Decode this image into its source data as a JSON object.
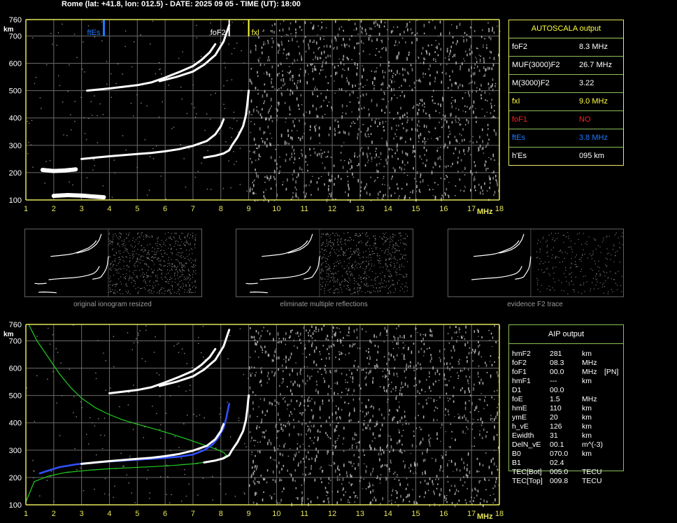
{
  "title": "Rome (lat: +41.8, lon: 012.5) - DATE: 2025 09 05 - TIME (UT): 18:00",
  "colors": {
    "axis": "#e6e65a",
    "grid": "#6a6a6a",
    "trace": "#ffffff",
    "ftEs": "#1e7bff",
    "fxl": "#ffff40",
    "foF1": "#ff2020",
    "profile": "#20d020",
    "blue": "#3050ff"
  },
  "chart_data": [
    {
      "type": "scatter",
      "panel": "main-ionogram",
      "xlabel": "MHz",
      "ylabel": "km",
      "xlim": [
        1,
        18
      ],
      "ylim": [
        100,
        760
      ],
      "xticks": [
        "1",
        "2",
        "3",
        "4",
        "5",
        "6",
        "7",
        "8",
        "9",
        "10",
        "11",
        "12",
        "13",
        "14",
        "15",
        "16",
        "17",
        "18"
      ],
      "yticks": [
        "100",
        "200",
        "300",
        "400",
        "500",
        "600",
        "700",
        "760"
      ],
      "grid": true,
      "markers": [
        {
          "label": "ftEs",
          "x": 3.8,
          "color": "#1e7bff"
        },
        {
          "label": "foF2",
          "x": 8.3,
          "color": "#ffffff"
        },
        {
          "label": "fxl",
          "x": 9.0,
          "color": "#ffff40"
        }
      ],
      "series": [
        {
          "x": [
            2.0,
            2.5,
            3.0,
            3.5,
            3.8
          ],
          "y": [
            115,
            118,
            116,
            112,
            110
          ]
        },
        {
          "x": [
            1.6,
            2.0,
            2.4,
            2.8
          ],
          "y": [
            210,
            206,
            208,
            212
          ]
        },
        {
          "x": [
            3.0,
            3.5,
            4.0,
            4.5,
            5.0,
            5.5,
            6.0,
            6.5,
            7.0,
            7.5,
            7.8,
            8.0,
            8.1
          ],
          "y": [
            250,
            255,
            260,
            264,
            268,
            272,
            278,
            286,
            298,
            316,
            340,
            370,
            395
          ]
        },
        {
          "x": [
            7.4,
            7.8,
            8.1,
            8.3,
            8.4,
            8.6,
            8.8,
            8.9,
            8.95,
            9.0
          ],
          "y": [
            255,
            262,
            270,
            282,
            300,
            330,
            370,
            410,
            450,
            500
          ]
        },
        {
          "x": [
            3.2,
            4.0,
            5.0,
            5.5,
            6.0,
            6.5,
            7.0,
            7.3,
            7.6,
            7.8
          ],
          "y": [
            500,
            508,
            520,
            530,
            548,
            568,
            590,
            612,
            640,
            670
          ]
        },
        {
          "x": [
            5.8,
            6.4,
            7.0,
            7.4,
            7.8,
            8.1,
            8.3
          ],
          "y": [
            535,
            550,
            570,
            595,
            630,
            680,
            740
          ]
        }
      ]
    },
    {
      "type": "line",
      "panel": "aip-ionogram",
      "xlabel": "MHz",
      "ylabel": "km",
      "xlim": [
        1,
        18
      ],
      "ylim": [
        100,
        760
      ],
      "xticks": [
        "1",
        "2",
        "3",
        "4",
        "5",
        "6",
        "7",
        "8",
        "9",
        "10",
        "11",
        "12",
        "13",
        "14",
        "15",
        "16",
        "17",
        "18"
      ],
      "yticks": [
        "100",
        "200",
        "300",
        "400",
        "500",
        "600",
        "700",
        "760"
      ],
      "grid": true,
      "series": [
        {
          "color": "#20d020",
          "x": [
            1.1,
            1.4,
            1.8,
            2.2,
            2.6,
            3.0,
            3.5,
            4.0,
            4.5,
            5.0,
            5.6,
            6.2,
            6.8,
            7.3,
            7.8,
            8.1,
            8.2,
            8.0,
            7.6,
            7.0,
            6.4,
            5.6,
            4.8,
            4.0,
            3.2,
            2.4,
            1.8,
            1.3,
            1.0
          ],
          "y": [
            760,
            700,
            640,
            580,
            530,
            490,
            455,
            430,
            410,
            395,
            378,
            360,
            340,
            322,
            305,
            292,
            281,
            268,
            258,
            250,
            245,
            240,
            236,
            232,
            226,
            218,
            205,
            185,
            110
          ]
        },
        {
          "color": "#3050ff",
          "x": [
            1.5,
            1.8,
            2.2,
            2.8,
            3.5,
            4.2,
            5.0,
            5.8,
            6.5,
            7.0,
            7.4,
            7.7,
            7.9,
            8.1,
            8.2,
            8.3
          ],
          "y": [
            215,
            225,
            238,
            248,
            255,
            260,
            265,
            270,
            276,
            284,
            300,
            320,
            345,
            380,
            420,
            470
          ]
        },
        {
          "color": "#ffffff",
          "x": [
            3.0,
            3.5,
            4.0,
            4.5,
            5.0,
            5.5,
            6.0,
            6.5,
            7.0,
            7.5,
            7.8,
            8.0,
            8.1
          ],
          "y": [
            250,
            255,
            260,
            264,
            268,
            272,
            278,
            286,
            298,
            316,
            340,
            370,
            395
          ]
        },
        {
          "color": "#ffffff",
          "x": [
            7.4,
            7.8,
            8.1,
            8.3,
            8.4,
            8.6,
            8.8,
            8.9,
            8.95,
            9.0
          ],
          "y": [
            255,
            262,
            270,
            282,
            300,
            330,
            370,
            410,
            450,
            500
          ]
        },
        {
          "color": "#ffffff",
          "x": [
            4.0,
            5.0,
            5.5,
            6.0,
            6.5,
            7.0,
            7.3,
            7.6,
            7.8
          ],
          "y": [
            508,
            520,
            530,
            548,
            568,
            590,
            612,
            640,
            670
          ]
        },
        {
          "color": "#ffffff",
          "x": [
            5.8,
            6.4,
            7.0,
            7.4,
            7.8,
            8.1,
            8.3
          ],
          "y": [
            535,
            550,
            570,
            595,
            630,
            680,
            740
          ]
        }
      ]
    }
  ],
  "thumbnails": [
    {
      "caption": "original ionogram resized"
    },
    {
      "caption": "eliminate multiple reflections"
    },
    {
      "caption": "evidence F2 trace"
    }
  ],
  "autoscala": {
    "header": "AUTOSCALA output",
    "rows": [
      {
        "label": "foF2",
        "value": "8.3 MHz",
        "color": "#ffffff"
      },
      {
        "label": "MUF(3000)F2",
        "value": "26.7 MHz",
        "color": "#ffffff"
      },
      {
        "label": "M(3000)F2",
        "value": "3.22",
        "color": "#ffffff"
      },
      {
        "label": "fxI",
        "value": "9.0 MHz",
        "color": "#ffff40"
      },
      {
        "label": "foF1",
        "value": "NO",
        "color": "#ff2020"
      },
      {
        "label": "ftEs",
        "value": "3.8 MHz",
        "color": "#1e7bff"
      },
      {
        "label": "h'Es",
        "value": "095    km",
        "color": "#ffffff"
      }
    ]
  },
  "aip": {
    "header": "AIP output",
    "rows": [
      {
        "label": "hmF2",
        "value": "281",
        "unit": "km",
        "extra": ""
      },
      {
        "label": "foF2",
        "value": "08.3",
        "unit": "MHz",
        "extra": ""
      },
      {
        "label": "foF1",
        "value": "00.0",
        "unit": "MHz",
        "extra": "[PN]"
      },
      {
        "label": "hmF1",
        "value": "---",
        "unit": "km",
        "extra": ""
      },
      {
        "label": "D1",
        "value": "00.0",
        "unit": "",
        "extra": ""
      },
      {
        "label": "foE",
        "value": "1.5",
        "unit": "MHz",
        "extra": ""
      },
      {
        "label": "hmE",
        "value": "110",
        "unit": "km",
        "extra": ""
      },
      {
        "label": "ymE",
        "value": "20",
        "unit": "km",
        "extra": ""
      },
      {
        "label": "h_vE",
        "value": "126",
        "unit": "km",
        "extra": ""
      },
      {
        "label": "Ewidth",
        "value": "31",
        "unit": "km",
        "extra": ""
      },
      {
        "label": "DelN_vE",
        "value": "00.1",
        "unit": "m^(-3)",
        "extra": ""
      },
      {
        "label": "B0",
        "value": "070.0",
        "unit": "km",
        "extra": ""
      },
      {
        "label": "B1",
        "value": "02.4",
        "unit": "",
        "extra": ""
      },
      {
        "label": "TEC[Bot]",
        "value": "005.0",
        "unit": "TECU",
        "extra": ""
      },
      {
        "label": "TEC[Top]",
        "value": "009.8",
        "unit": "TECU",
        "extra": ""
      }
    ]
  }
}
